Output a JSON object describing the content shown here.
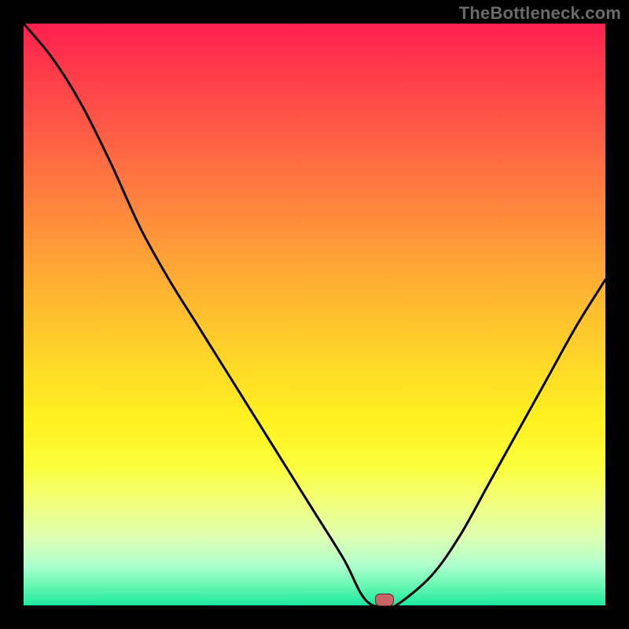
{
  "watermark": "TheBottleneck.com",
  "colors": {
    "background": "#000000",
    "gradient_top": "#ff1f4f",
    "gradient_bottom": "#1de9a0",
    "curve": "#000000",
    "marker_fill": "#c86464",
    "marker_border": "#000000"
  },
  "chart_data": {
    "type": "line",
    "title": "",
    "xlabel": "",
    "ylabel": "",
    "xlim": [
      0,
      100
    ],
    "ylim": [
      0,
      100
    ],
    "x": [
      0,
      5,
      10,
      15,
      20,
      25,
      30,
      35,
      40,
      45,
      50,
      55,
      58,
      60,
      62,
      64,
      70,
      75,
      80,
      85,
      90,
      95,
      100
    ],
    "values": [
      100,
      94,
      86,
      76,
      65,
      56,
      48,
      40,
      32,
      24,
      16,
      8,
      2,
      0,
      0,
      0,
      5,
      12,
      21,
      30,
      39,
      48,
      56
    ],
    "marker": {
      "x": 62,
      "y": 0
    }
  }
}
